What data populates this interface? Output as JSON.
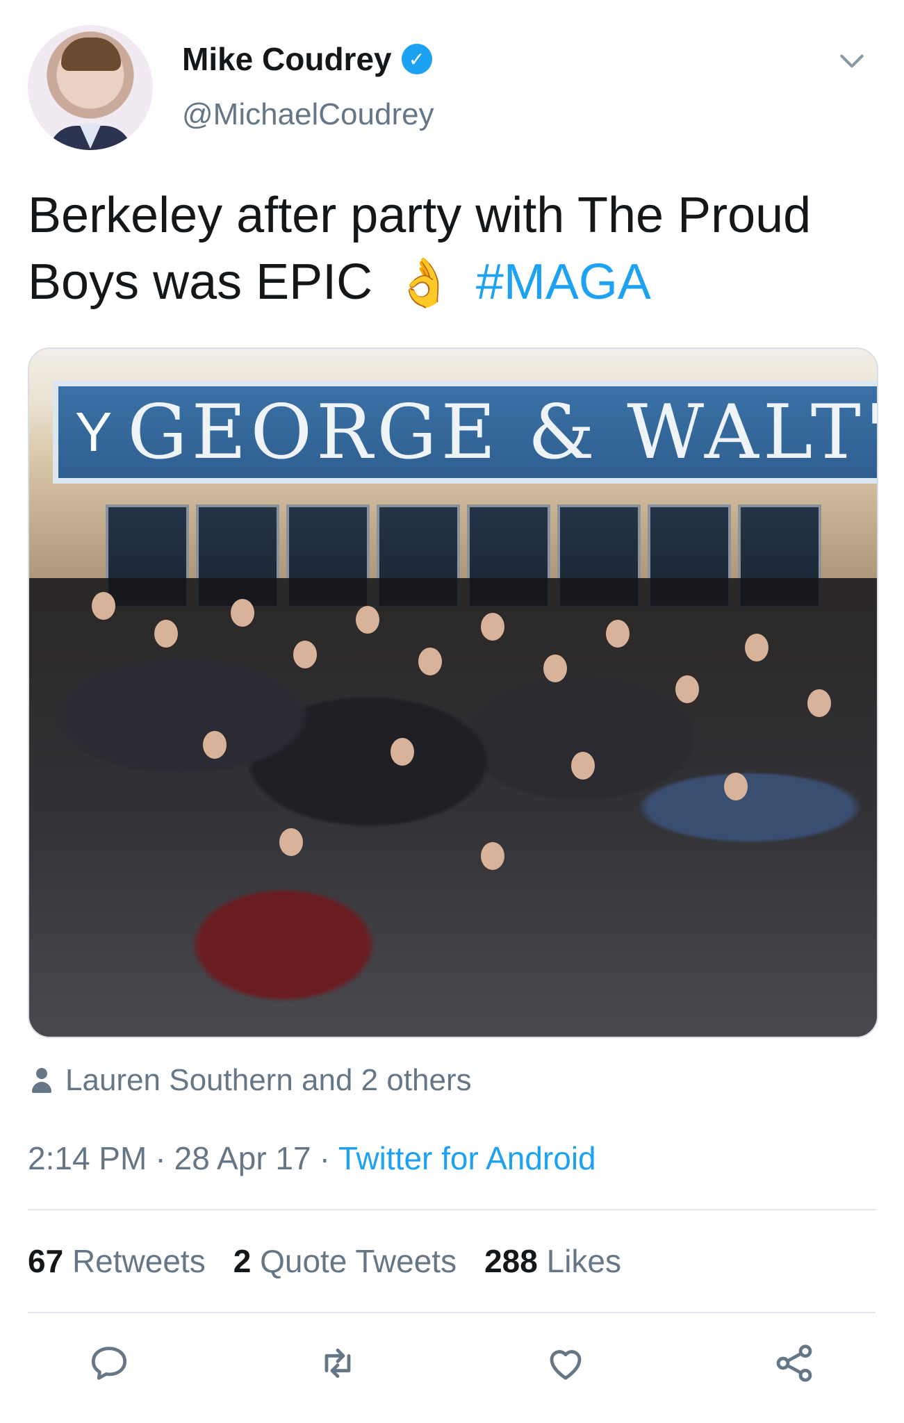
{
  "author": {
    "name": "Mike Coudrey",
    "handle": "@MichaelCoudrey",
    "verified_badge": "✓"
  },
  "tweet": {
    "text_main": "Berkeley after party with The Proud Boys was EPIC",
    "emoji": "👌",
    "hashtag": "#MAGA"
  },
  "media": {
    "sign_text": "GEORGE & WALT'S",
    "glass_icon": "Y"
  },
  "social_context": "Lauren Southern and 2 others",
  "meta": {
    "time": "2:14 PM",
    "sep1": "·",
    "date": "28 Apr 17",
    "sep2": "·",
    "source": "Twitter for Android"
  },
  "stats": {
    "retweets_count": "67",
    "retweets_label": "Retweets",
    "quotes_count": "2",
    "quotes_label": "Quote Tweets",
    "likes_count": "288",
    "likes_label": "Likes"
  },
  "icons": [
    "chevron-down-icon",
    "person-icon",
    "reply-icon",
    "retweet-icon",
    "like-icon",
    "share-icon"
  ],
  "colors": {
    "link": "#1da1f2",
    "secondary_text": "#657786",
    "primary_text": "#14171a"
  }
}
